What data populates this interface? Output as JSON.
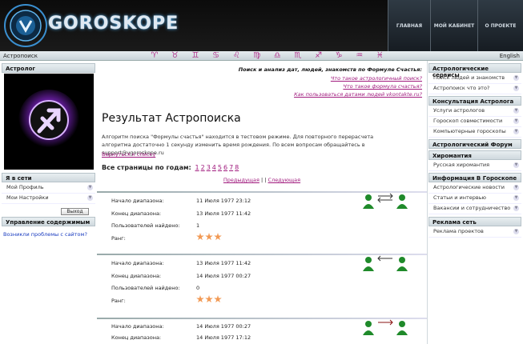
{
  "header": {
    "logo_text": "GOROSKOPE",
    "nav": [
      "ГЛАВНАЯ",
      "МОЙ КАБИНЕТ",
      "О ПРОЕКТЕ"
    ]
  },
  "topbar": {
    "left": "Астропоиск",
    "right": "English",
    "signs": [
      "♈",
      "♉",
      "♊",
      "♋",
      "♌",
      "♍",
      "♎",
      "♏",
      "♐",
      "♑",
      "♒",
      "♓"
    ]
  },
  "left": {
    "astrologer_title": "Астролог",
    "online_title": "Я в сети",
    "online_items": [
      "Мой Профиль",
      "Мои Настройки"
    ],
    "logout": "Выход",
    "content_title": "Управление содержимым",
    "problem_link": "Возникли проблемы с сайтом?"
  },
  "main": {
    "q1": "Поиск и анализ дат, людей, знакомств по Формуле Счастья:",
    "q2": "Что такое астрологичный поиск?",
    "q3": "Что такое формула счастья?",
    "q4": "Как пользоваться датами людей vkontakte.ru?",
    "title": "Результат Астропоиска",
    "text": "Алгоритм поиска \"Формулы счастья\" находится в тестовом режиме. Для повторного перерасчета алгоритма достаточно 1 секунду изменить время рождения. По всем вопросам обращайтесь в support@vgoroskope.ru",
    "back": "Вернуться к списку",
    "years_label": "Все страницы по годам:",
    "years": [
      "1",
      "2",
      "3",
      "4",
      "5",
      "6",
      "7",
      "8"
    ],
    "prev": "Предыдущая",
    "sep": "|",
    "next": "Следующая",
    "labels": {
      "start": "Начало диапазона:",
      "end": "Конец диапазона:",
      "found": "Пользователей найдено:",
      "rank": "Ранг:"
    },
    "results": [
      {
        "start": "11 Июля 1977 23:12",
        "end": "13 Июля 1977 11:42",
        "found": "1",
        "stars": 3
      },
      {
        "start": "13 Июля 1977 11:42",
        "end": "14 Июля 1977 00:27",
        "found": "0",
        "stars": 3
      },
      {
        "start": "14 Июля 1977 00:27",
        "end": "14 Июля 1977 17:12",
        "found": "",
        "stars": 0
      }
    ]
  },
  "right": {
    "sections": [
      {
        "title": "Астрологические сервисы",
        "items": [
          "Поиск людей и знакомств",
          "Астропоиск что это?"
        ]
      },
      {
        "title": "Консультация Астролога",
        "items": [
          "Услуги астрологов",
          "Гороскоп совместимости",
          "Компьютерные гороскопы"
        ]
      },
      {
        "title": "Астрологический Форум",
        "items": []
      },
      {
        "title": "Хиромантия",
        "items": [
          "Русская хиромантия"
        ]
      },
      {
        "title": "Информация В Гороскопе",
        "items": [
          "Астрологические новости",
          "Статьи и интервью",
          "Вакансии и сотрудничество"
        ]
      },
      {
        "title": "Реклама сеть",
        "items": [
          "Реклама проектов"
        ]
      }
    ]
  }
}
